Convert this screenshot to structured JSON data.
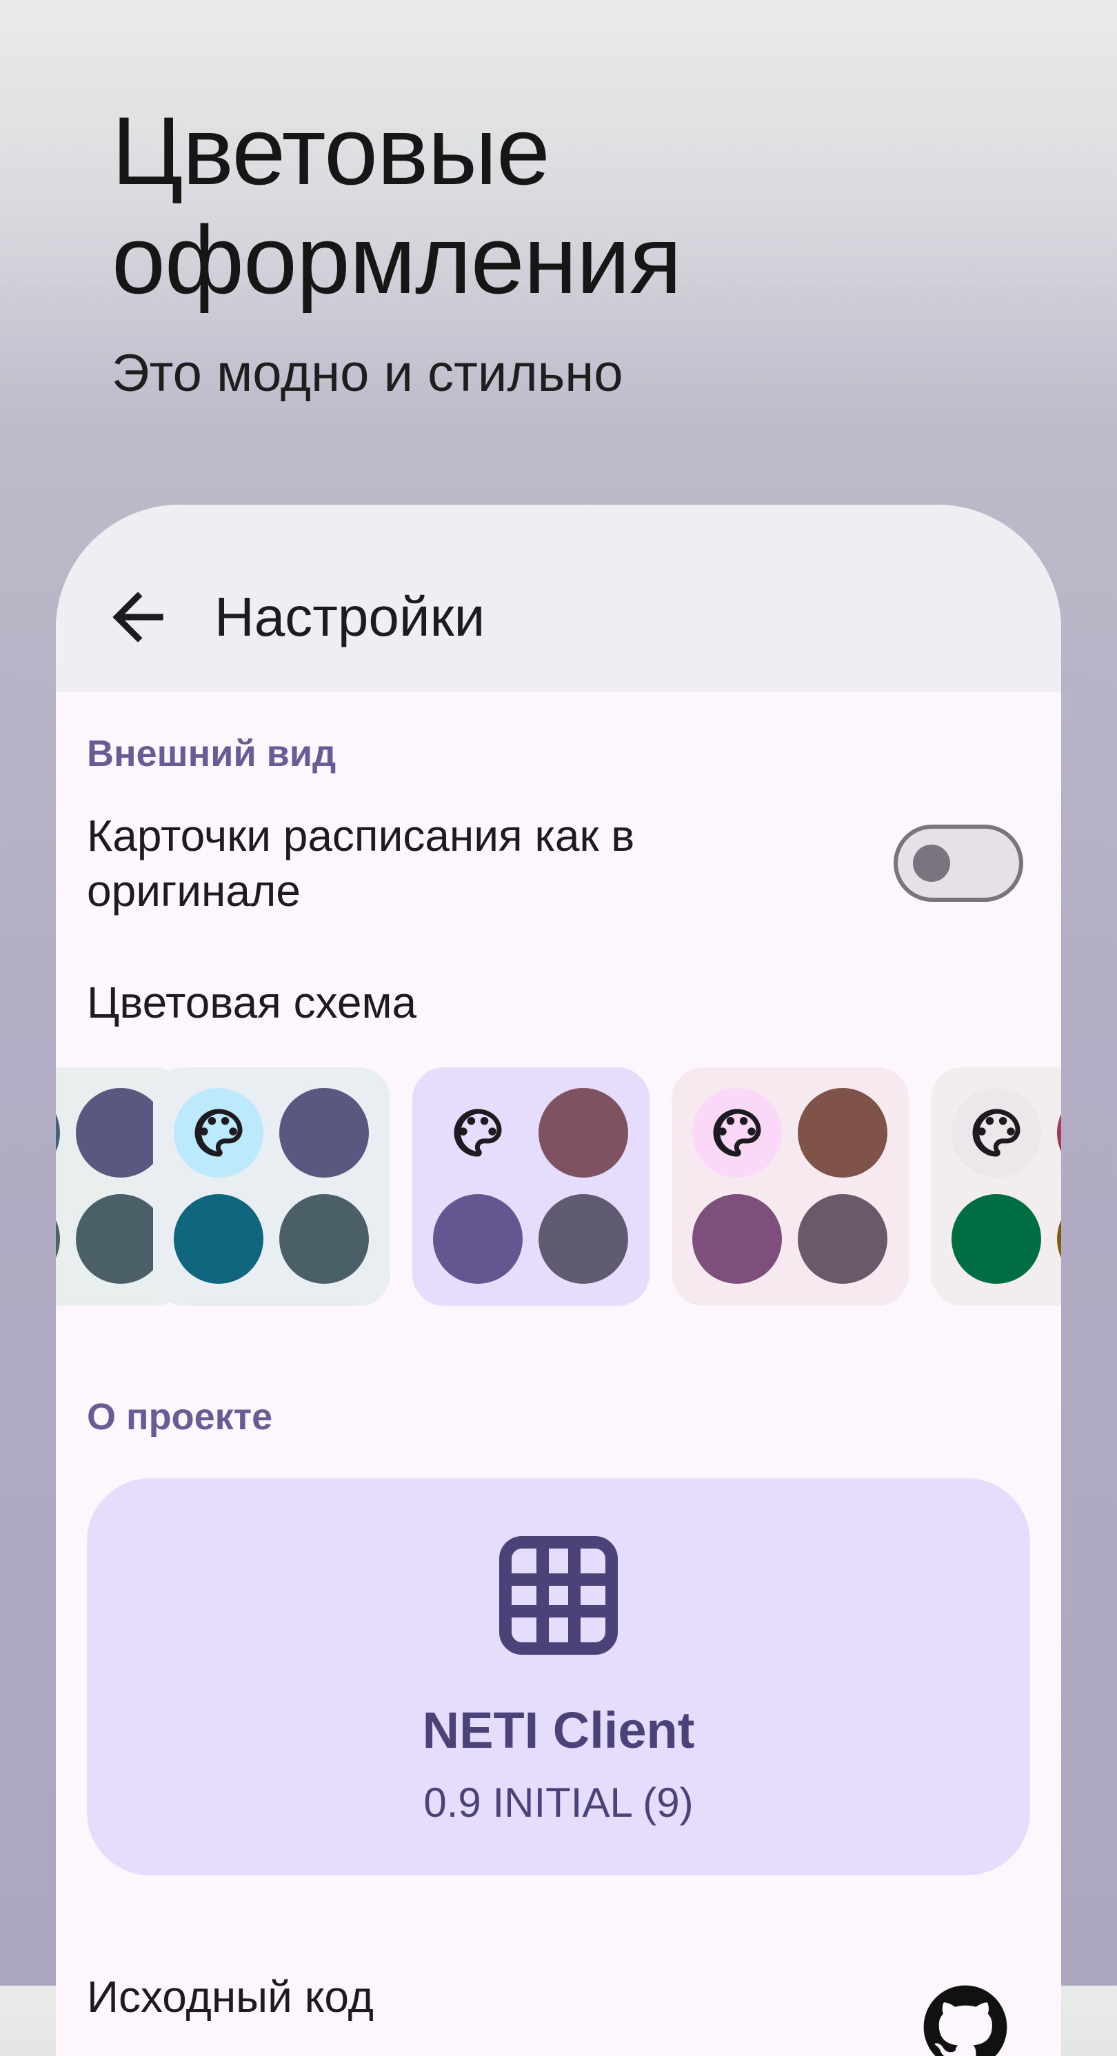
{
  "hero": {
    "title_line1": "Цветовые",
    "title_line2": "оформления",
    "subtitle": "Это модно и стильно"
  },
  "appbar": {
    "title": "Настройки",
    "back_icon": "arrow-back-icon"
  },
  "appearance": {
    "header": "Внешний вид",
    "original_cards_label": "Карточки расписания как в оригинале",
    "original_cards_enabled": false,
    "color_scheme_label": "Цветовая схема",
    "schemes": [
      {
        "background": "#e9eeee",
        "colors": [
          "#466179",
          "#5a5880",
          "#4a665f",
          "#4b5f69"
        ],
        "selected": false
      },
      {
        "background": "#e9eef2",
        "accent": "#bce9fb",
        "colors": [
          "#5a5880",
          "#10667f",
          "#4b5f69"
        ],
        "selected": false
      },
      {
        "background": "#e6dcfb",
        "accent": "#e6dcfb",
        "colors": [
          "#7e5260",
          "#655591",
          "#605b71"
        ],
        "selected": true
      },
      {
        "background": "#f6eaf0",
        "accent": "#fbd8f8",
        "colors": [
          "#7f5349",
          "#7e4f7d",
          "#6b5869"
        ],
        "selected": false
      },
      {
        "background": "#f2eef0",
        "accent": "#ece7ea",
        "colors": [
          "#a23a5a",
          "#006d43",
          "#7a5a14"
        ],
        "selected": false
      }
    ]
  },
  "about": {
    "header": "О проекте",
    "app_name": "NETI Client",
    "app_version": "0.9 INITIAL (9)",
    "app_icon": "grid-icon"
  },
  "source": {
    "label": "Исходный код",
    "icon": "github-icon"
  },
  "colors": {
    "accent": "#685c95",
    "card": "#e6dcfb",
    "surface": "#fdf7fd"
  }
}
